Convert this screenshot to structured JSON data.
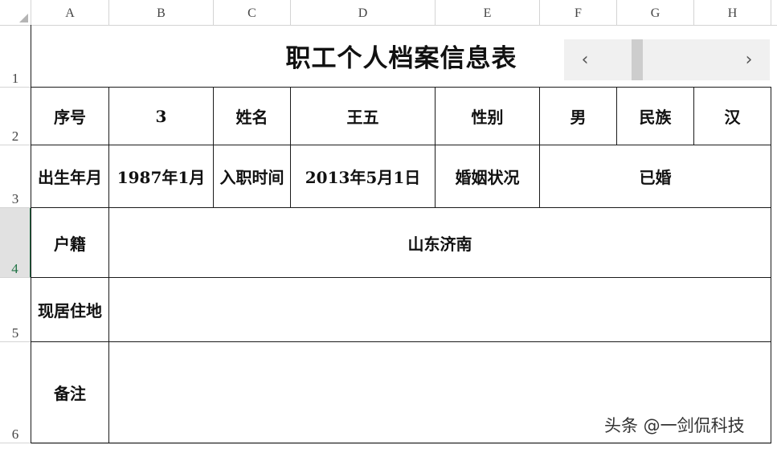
{
  "columns": [
    "A",
    "B",
    "C",
    "D",
    "E",
    "F",
    "G",
    "H"
  ],
  "rows": [
    "1",
    "2",
    "3",
    "4",
    "5",
    "6"
  ],
  "selected_row": "4",
  "sheet": {
    "title": "职工个人档案信息表",
    "row2": {
      "seq_label": "序号",
      "seq_value": "3",
      "name_label": "姓名",
      "name_value": "王五",
      "gender_label": "性别",
      "gender_value": "男",
      "ethnicity_label": "民族",
      "ethnicity_value": "汉"
    },
    "row3": {
      "birth_label": "出生年月",
      "birth_value": "1987年1月",
      "hire_label": "入职时间",
      "hire_value": "2013年5月1日",
      "marital_label": "婚姻状况",
      "marital_value": "已婚"
    },
    "row4": {
      "hukou_label": "户籍",
      "hukou_value": "山东济南"
    },
    "row5": {
      "residence_label": "现居住地",
      "residence_value": ""
    },
    "row6": {
      "notes_label": "备注",
      "notes_value": ""
    }
  },
  "scrollbar": {
    "left_arrow": "‹",
    "right_arrow": "›"
  },
  "watermark": "头条 @一剑侃科技",
  "colors": {
    "grid": "#1a1a1a",
    "header_grid": "#d4d4d4",
    "selected_header": "#217346",
    "scroll_bg": "#f0f0f0"
  }
}
